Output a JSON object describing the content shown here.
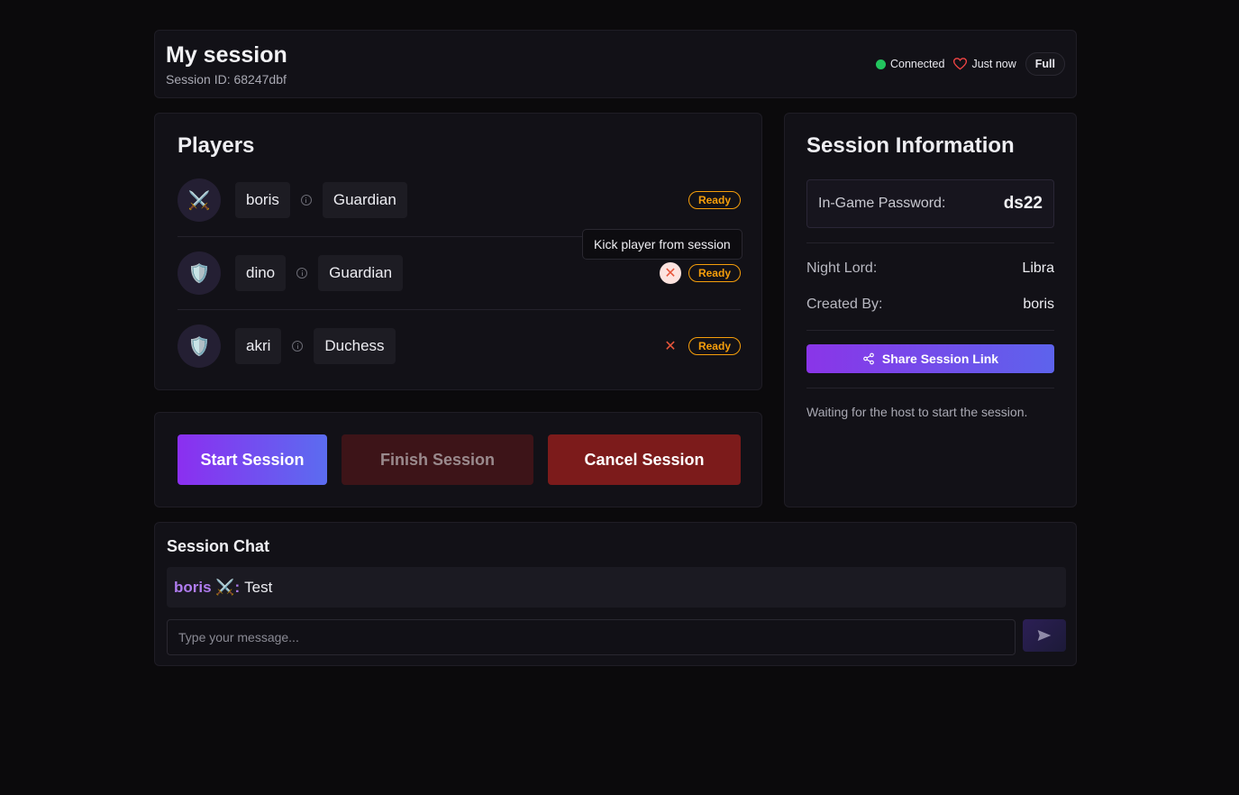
{
  "header": {
    "title": "My session",
    "session_id": "Session ID: 68247dbf",
    "status_connected": "Connected",
    "status_heartbeat": "Just now",
    "capacity_badge": "Full",
    "connected_color": "#22c55e"
  },
  "players": {
    "title": "Players",
    "list": [
      {
        "name": "boris",
        "avatar_icon": "crossed-swords-icon",
        "avatar": "⚔️",
        "role": "Guardian",
        "status": "Ready",
        "kick_visible": false
      },
      {
        "name": "dino",
        "avatar_icon": "shield-icon",
        "avatar": "🛡️",
        "role": "Guardian",
        "status": "Ready",
        "kick_visible": true
      },
      {
        "name": "akri",
        "avatar_icon": "shield-icon",
        "avatar": "🛡️",
        "role": "Duchess",
        "status": "Ready",
        "kick_visible": true
      }
    ],
    "kick_tooltip": "Kick player from session"
  },
  "actions": {
    "start": "Start Session",
    "finish": "Finish Session",
    "cancel": "Cancel Session"
  },
  "session_info": {
    "title": "Session Information",
    "password_label": "In-Game Password:",
    "password_value": "ds22",
    "night_lord_label": "Night Lord:",
    "night_lord_value": "Libra",
    "created_by_label": "Created By:",
    "created_by_value": "boris",
    "share_label": "Share Session Link",
    "waiting_text": "Waiting for the host to start the session."
  },
  "chat": {
    "title": "Session Chat",
    "messages": [
      {
        "author": "boris ⚔️:",
        "text": "Test"
      }
    ],
    "input_placeholder": "Type your message..."
  }
}
